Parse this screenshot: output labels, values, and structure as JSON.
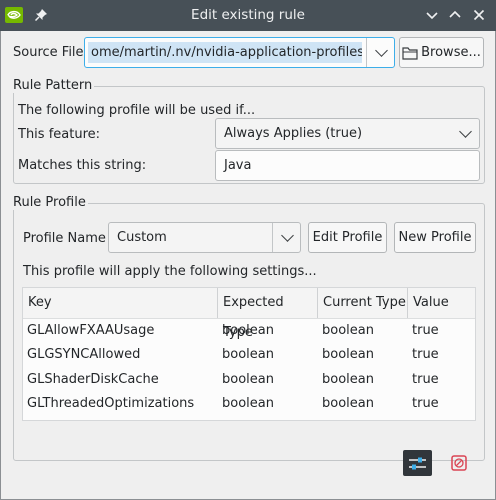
{
  "window": {
    "title": "Edit existing rule"
  },
  "source": {
    "label": "Source File",
    "value": "ome/martin/.nv/nvidia-application-profiles-rc",
    "browse_label": "Browse..."
  },
  "pattern": {
    "group_title": "Rule Pattern",
    "description": "The following profile will be used if...",
    "feature_label": "This feature:",
    "feature_value": "Always Applies (true)",
    "match_label": "Matches this string:",
    "match_value": "Java"
  },
  "profile": {
    "group_title": "Rule Profile",
    "name_label": "Profile Name",
    "name_value": "Custom",
    "edit_label": "Edit Profile",
    "new_label": "New Profile",
    "description": "This profile will apply the following settings...",
    "columns": [
      "Key",
      "Expected Type",
      "Current Type",
      "Value"
    ],
    "rows": [
      [
        "GLAllowFXAAUsage",
        "boolean",
        "boolean",
        "true"
      ],
      [
        "GLGSYNCAllowed",
        "boolean",
        "boolean",
        "true"
      ],
      [
        "GLShaderDiskCache",
        "boolean",
        "boolean",
        "true"
      ],
      [
        "GLThreadedOptimizations",
        "boolean",
        "boolean",
        "true"
      ]
    ]
  },
  "colors": {
    "titlebar": "#475057",
    "selection": "#cfe4f5",
    "accent": "#3daee9",
    "nvidia_green": "#76b900",
    "cancel_red": "#da4453"
  }
}
